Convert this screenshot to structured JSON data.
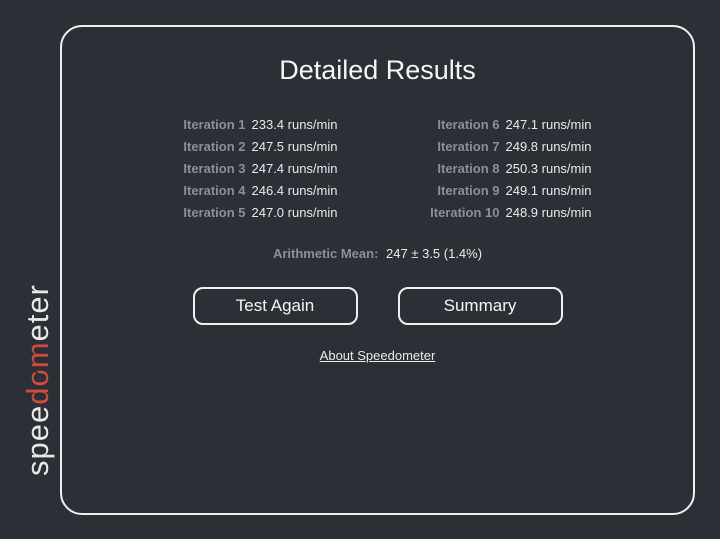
{
  "logo": {
    "part1": "spee",
    "part2_d": "d",
    "part2_o": "o",
    "part2_m": "m",
    "part3": "eter"
  },
  "title": "Detailed Results",
  "unit": "runs/min",
  "iterations_left": [
    {
      "label": "Iteration 1",
      "value": "233.4 runs/min"
    },
    {
      "label": "Iteration 2",
      "value": "247.5 runs/min"
    },
    {
      "label": "Iteration 3",
      "value": "247.4 runs/min"
    },
    {
      "label": "Iteration 4",
      "value": "246.4 runs/min"
    },
    {
      "label": "Iteration 5",
      "value": "247.0 runs/min"
    }
  ],
  "iterations_right": [
    {
      "label": "Iteration 6",
      "value": "247.1 runs/min"
    },
    {
      "label": "Iteration 7",
      "value": "249.8 runs/min"
    },
    {
      "label": "Iteration 8",
      "value": "250.3 runs/min"
    },
    {
      "label": "Iteration 9",
      "value": "249.1 runs/min"
    },
    {
      "label": "Iteration 10",
      "value": "248.9 runs/min"
    }
  ],
  "mean": {
    "label": "Arithmetic Mean:",
    "value": "247 ± 3.5 (1.4%)"
  },
  "buttons": {
    "test_again": "Test Again",
    "summary": "Summary"
  },
  "about": {
    "label": "About Speedometer"
  }
}
